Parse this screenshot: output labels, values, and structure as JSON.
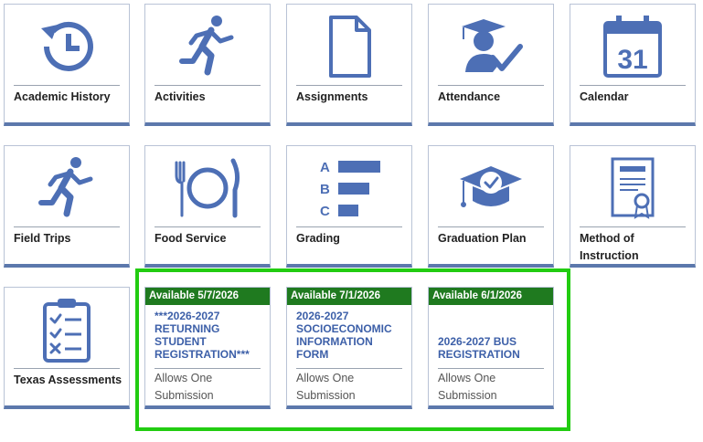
{
  "tiles": [
    {
      "label": "Academic History",
      "icon": "history-icon"
    },
    {
      "label": "Activities",
      "icon": "running-person-icon"
    },
    {
      "label": "Assignments",
      "icon": "document-icon"
    },
    {
      "label": "Attendance",
      "icon": "graduate-check-icon"
    },
    {
      "label": "Calendar",
      "icon": "calendar-icon",
      "day": "31"
    },
    {
      "label": "Field Trips",
      "icon": "running-person-icon"
    },
    {
      "label": "Food Service",
      "icon": "plate-fork-knife-icon"
    },
    {
      "label": "Grading",
      "icon": "grade-bars-icon",
      "letters": [
        "A",
        "B",
        "C"
      ]
    },
    {
      "label": "Graduation Plan",
      "icon": "mortarboard-check-icon"
    },
    {
      "label": "Method of Instruction",
      "icon": "certificate-icon"
    },
    {
      "label": "Texas Assessments",
      "icon": "clipboard-checklist-icon"
    }
  ],
  "forms": [
    {
      "banner": "Available 5/7/2026",
      "title": "***2026-2027 RETURNING STUDENT REGISTRATION***",
      "subtitle": "Allows One Submission"
    },
    {
      "banner": "Available 7/1/2026",
      "title": "2026-2027 SOCIOECONOMIC INFORMATION FORM",
      "subtitle": "Allows One Submission"
    },
    {
      "banner": "Available 6/1/2026",
      "title": "2026-2027 BUS REGISTRATION",
      "subtitle": "Allows One Submission"
    }
  ],
  "colors": {
    "icon": "#4d6fb5",
    "banner": "#1f7a1f",
    "highlight": "#22cc11",
    "tile_bottom": "#5c78ac"
  }
}
